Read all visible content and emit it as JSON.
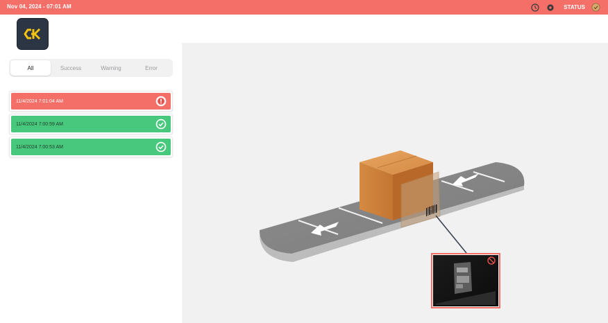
{
  "topbar": {
    "datetime": "Nov 04, 2024 - 07:01 AM",
    "status_label": "STATUS",
    "icons": [
      "clock-icon",
      "settings-icon",
      "status-ok-icon"
    ]
  },
  "logo": {
    "icon": "ck-logo"
  },
  "tabs": [
    {
      "label": "All",
      "active": true
    },
    {
      "label": "Success",
      "active": false
    },
    {
      "label": "Warning",
      "active": false
    },
    {
      "label": "Error",
      "active": false
    }
  ],
  "events": [
    {
      "timestamp": "11/4/2024 7:01:04 AM",
      "status": "error",
      "icon": "error-icon"
    },
    {
      "timestamp": "11/4/2024 7:00:59 AM",
      "status": "success",
      "icon": "check-icon"
    },
    {
      "timestamp": "11/4/2024 7:00:53 AM",
      "status": "success",
      "icon": "check-icon"
    }
  ],
  "scene": {
    "camera_preview_status_icon": "no-read-icon"
  },
  "colors": {
    "error": "#f36f68",
    "success": "#48c87c",
    "logo_bg": "#2c3544",
    "logo_accent": "#f5c211"
  }
}
